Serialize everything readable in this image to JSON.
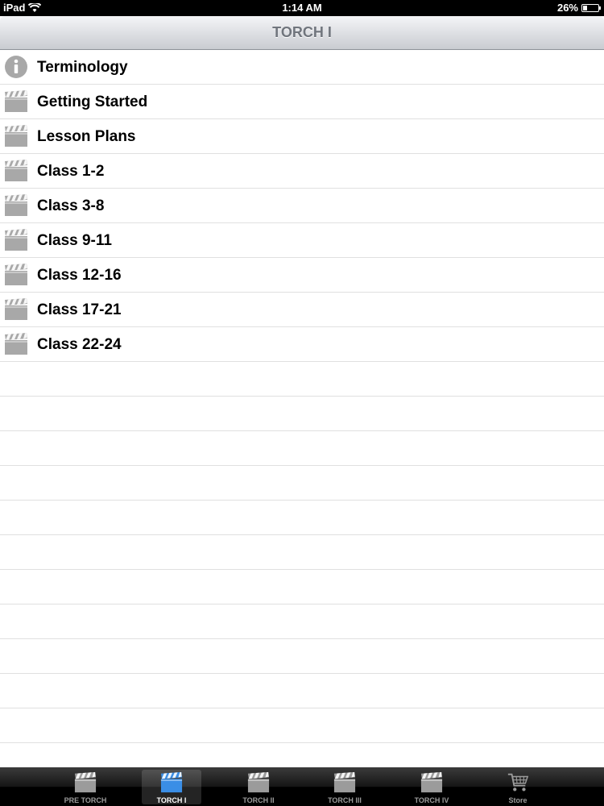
{
  "status_bar": {
    "device": "iPad",
    "time": "1:14 AM",
    "battery_text": "26%",
    "battery_level": 0.26
  },
  "nav": {
    "title": "TORCH I"
  },
  "list": {
    "items": [
      {
        "label": "Terminology",
        "icon": "info-icon"
      },
      {
        "label": "Getting Started",
        "icon": "clapperboard-icon"
      },
      {
        "label": "Lesson Plans",
        "icon": "clapperboard-icon"
      },
      {
        "label": "Class 1-2",
        "icon": "clapperboard-icon"
      },
      {
        "label": "Class 3-8",
        "icon": "clapperboard-icon"
      },
      {
        "label": "Class 9-11",
        "icon": "clapperboard-icon"
      },
      {
        "label": "Class 12-16",
        "icon": "clapperboard-icon"
      },
      {
        "label": "Class 17-21",
        "icon": "clapperboard-icon"
      },
      {
        "label": "Class 22-24",
        "icon": "clapperboard-icon"
      }
    ]
  },
  "tab_bar": {
    "selected_index": 1,
    "tabs": [
      {
        "label": "PRE TORCH",
        "icon": "clapperboard-icon"
      },
      {
        "label": "TORCH I",
        "icon": "clapperboard-icon"
      },
      {
        "label": "TORCH II",
        "icon": "clapperboard-icon"
      },
      {
        "label": "TORCH III",
        "icon": "clapperboard-icon"
      },
      {
        "label": "TORCH IV",
        "icon": "clapperboard-icon"
      },
      {
        "label": "Store",
        "icon": "cart-icon"
      }
    ]
  },
  "colors": {
    "nav_title": "#70757d",
    "selected_tab_icon": "#3a8ee6",
    "tab_icon": "#9b9b9b",
    "list_icon": "#a8a8a8"
  }
}
